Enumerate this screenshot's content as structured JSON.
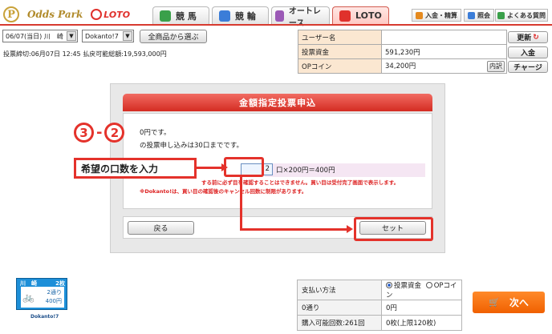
{
  "header": {
    "brand": "Odds Park",
    "brand_initial": "P",
    "loto_logo": "LOTO",
    "tabs": [
      {
        "label": "競 馬",
        "icon": "horse-icon",
        "color": "#3aa04a"
      },
      {
        "label": "競 輪",
        "icon": "bicycle-icon",
        "color": "#3b7dd8"
      },
      {
        "label": "オートレース",
        "icon": "motorbike-icon",
        "color": "#9b59b6"
      },
      {
        "label": "LOTO",
        "icon": "loto-icon",
        "color": "#e0312c"
      }
    ],
    "links": [
      {
        "label": "入金・精算",
        "icon": "wallet-icon"
      },
      {
        "label": "照会",
        "icon": "document-icon"
      },
      {
        "label": "よくある質問",
        "icon": "question-icon"
      }
    ]
  },
  "selectors": {
    "date_track": "06/07(当日) 川　崎",
    "product": "Dokanto!7",
    "all_products_button": "全商品から選ぶ",
    "deadline": "投票締切:06月07日 12:45 払戻可能総額:19,593,000円"
  },
  "account": {
    "rows": [
      {
        "label": "ユーザー名",
        "value": ""
      },
      {
        "label": "投票資金",
        "value": "591,230円"
      },
      {
        "label": "OPコイン",
        "value": "34,200円",
        "button": "内訳"
      }
    ],
    "update_button": "更新",
    "deposit_button": "入金",
    "charge_button": "チャージ"
  },
  "dialog": {
    "title": "金額指定投票申込",
    "line1": "0円です。",
    "line2": "の投票申し込みは30口までです。",
    "units_value": "2",
    "amount_text": "口×200円＝400円",
    "warning1": "する前に必ず目を確認することはできません。買い目は受付完了画面で表示します。",
    "warning2": "※Dokanto!は、買い目の確認後のキャンセル回数に制限があります。",
    "back_button": "戻る",
    "set_button": "セット"
  },
  "annotation": {
    "step_major": "3",
    "step_separator": "-",
    "step_minor": "2",
    "callout": "希望の口数を入力"
  },
  "ticket": {
    "venue": "川　崎",
    "count": "2枚",
    "units": "2通り",
    "amount": "400円",
    "caption": "Dokanto!7"
  },
  "payment": {
    "rows": [
      {
        "label": "支払い方法",
        "value": ""
      },
      {
        "label": "0通り",
        "value": "0円"
      },
      {
        "label": "購入可能回数:261回",
        "value": "0枚(上限120枚)"
      }
    ],
    "option_selected": "投票資金",
    "option_other": "OPコイン",
    "next_button": "次へ"
  },
  "colors": {
    "accent": "#e4322b",
    "header_bar": "#d73a2f",
    "next_button": "#f06000"
  }
}
